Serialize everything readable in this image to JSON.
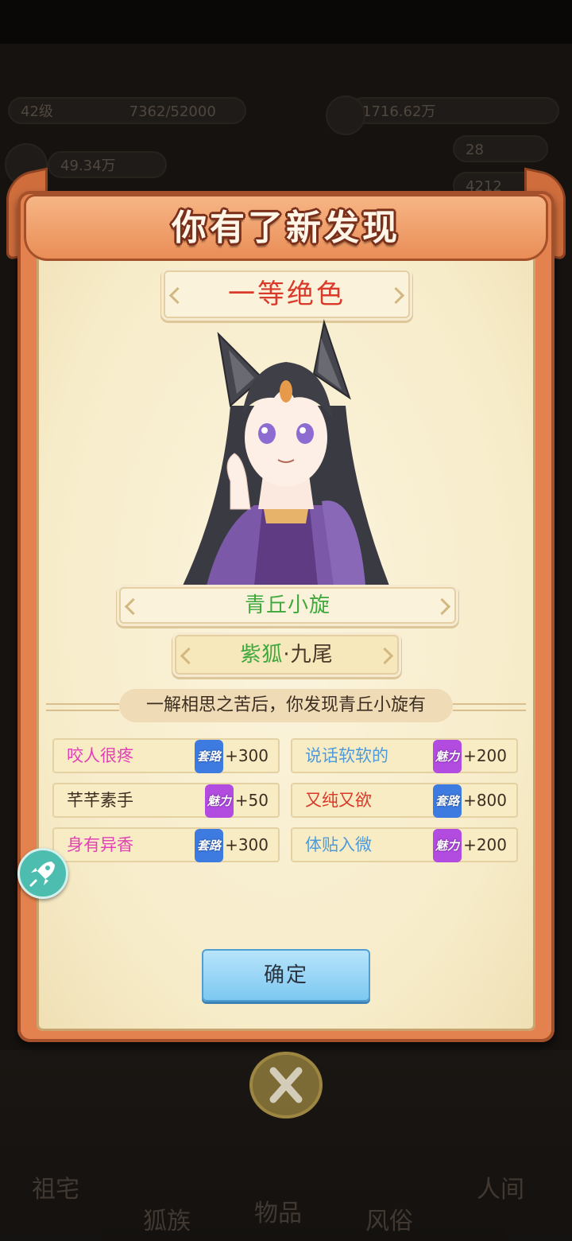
{
  "background": {
    "level": "42级",
    "exp": "7362/52000",
    "stat_left": "49.34万",
    "currency": "1716.62万",
    "stat_right_1": "28",
    "stat_right_2": "4212",
    "nav_items": [
      "祖宅",
      "狐族",
      "物品",
      "风俗",
      "人间"
    ]
  },
  "modal": {
    "title": "你有了新发现",
    "rank": "一等绝色",
    "character_name": "青丘小旋",
    "species_primary": "紫狐",
    "species_secondary": "·九尾",
    "description": "一解相思之苦后，你发现青丘小旋有",
    "traits": [
      {
        "name": "咬人很疼",
        "tag": "套路",
        "value": "+300"
      },
      {
        "name": "说话软软的",
        "tag": "魅力",
        "value": "+200"
      },
      {
        "name": "芊芊素手",
        "tag": "魅力",
        "value": "+50"
      },
      {
        "name": "又纯又欲",
        "tag": "套路",
        "value": "+800"
      },
      {
        "name": "身有异香",
        "tag": "套路",
        "value": "+300"
      },
      {
        "name": "体贴入微",
        "tag": "魅力",
        "value": "+200"
      }
    ],
    "confirm_label": "确定"
  },
  "colors": {
    "rank": "#d93a2a",
    "name": "#3fa83d",
    "tag_taolu": "#3d7be0",
    "tag_meili": "#b24be0",
    "frame": "#e4824f",
    "button": "#7dc8f1"
  }
}
